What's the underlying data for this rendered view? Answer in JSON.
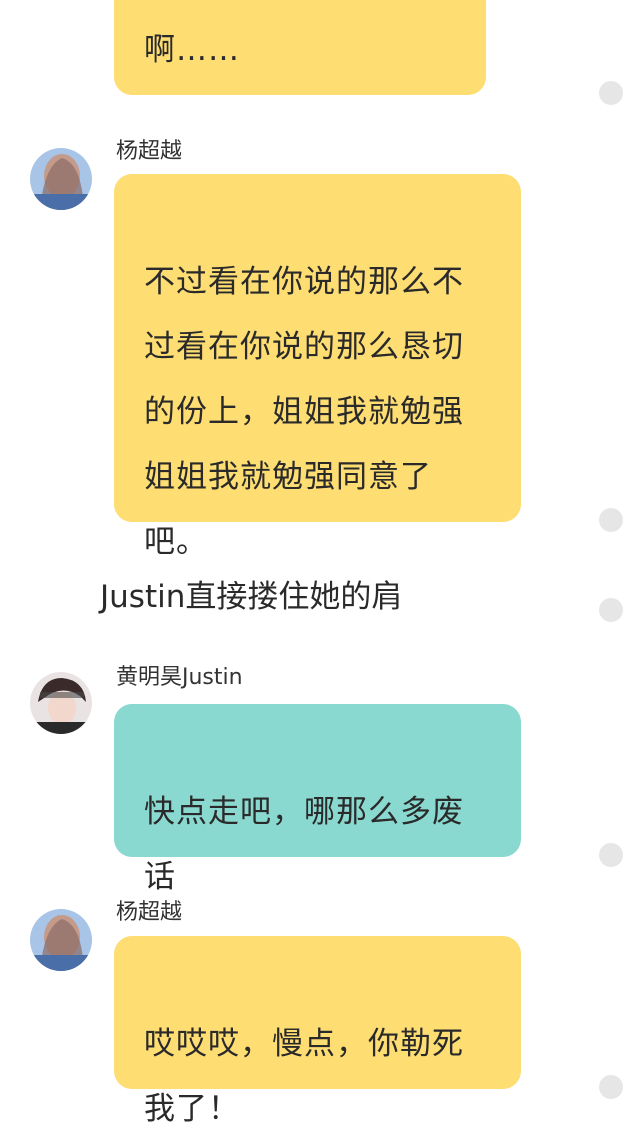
{
  "messages": [
    {
      "speaker": "",
      "text": "……"
    },
    {
      "speaker": "杨超越",
      "text": "不过看在你说的那么不过看在你说的那么恳切的份上，姐姐我就勉强姐姐我就勉强同意了吧。"
    },
    {
      "speaker": "",
      "text": "Justin直接搂住她的肩"
    },
    {
      "speaker": "黄明昊Justin",
      "text": "快点走吧，哪那么多废话"
    },
    {
      "speaker": "杨超越",
      "text": "哎哎哎，慢点，你勒死我了！"
    }
  ],
  "display": {
    "top_fragment": "有能不能劝管我照劝\n啊……",
    "msg2_lines": "不过看在你说的那么不\n过看在你说的那么恳切\n的份上，姐姐我就勉强\n姐姐我就勉强同意了\n吧。",
    "msg4_lines": "快点走吧，哪那么多废\n话",
    "msg5_lines": "哎哎哎，慢点，你勒死\n我了！"
  },
  "avatars": [
    {
      "person": "杨超越",
      "icon": "avatar-yang-chaoyue"
    },
    {
      "person": "黄明昊Justin",
      "icon": "avatar-justin"
    }
  ],
  "colors": {
    "yellow_bubble": "#fedd73",
    "teal_bubble": "#8ad9d0",
    "text": "#2a2a2a",
    "dot": "#e6e6e6"
  }
}
